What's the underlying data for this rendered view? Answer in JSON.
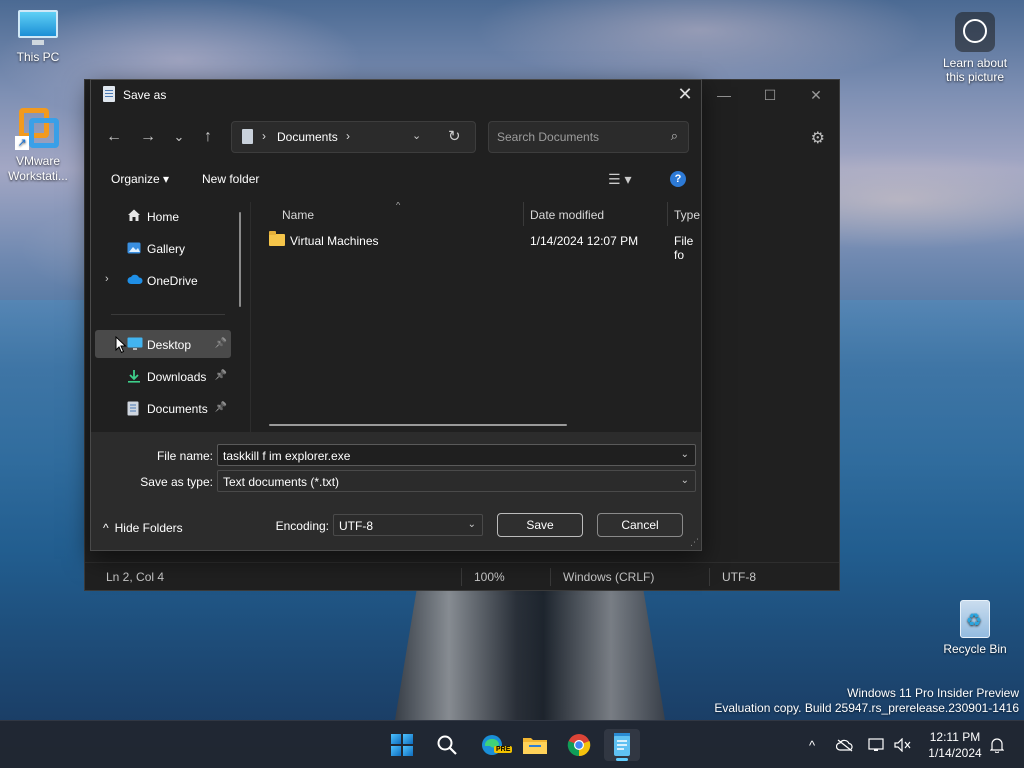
{
  "desktop": {
    "icons": [
      {
        "label": "This PC"
      },
      {
        "label": "VMware Workstati..."
      },
      {
        "label": "Recycle Bin"
      },
      {
        "label": "Learn about this picture"
      }
    ],
    "watermark": {
      "line1": "Windows 11 Pro Insider Preview",
      "line2": "Evaluation copy. Build 25947.rs_prerelease.230901-1416"
    }
  },
  "notepad": {
    "status": {
      "position": "Ln 2, Col 4",
      "zoom": "100%",
      "line_ending": "Windows (CRLF)",
      "encoding": "UTF-8"
    },
    "buttons": {
      "minimize": "—",
      "maximize": "☐",
      "close": "✕"
    },
    "settings_icon": "⚙"
  },
  "dialog": {
    "title": "Save as",
    "close_glyph": "✕",
    "nav": {
      "back": "←",
      "forward": "→",
      "recent": "⌄",
      "up": "↑"
    },
    "address": {
      "crumb": "Documents",
      "sep1": "›",
      "sep2": "›",
      "dropdown": "⌄",
      "refresh": "↻"
    },
    "search": {
      "placeholder": "Search Documents",
      "icon": "⌕"
    },
    "commands": {
      "organize": "Organize ▾",
      "new_folder": "New folder",
      "view": "☰ ▾",
      "help": "?"
    },
    "sidebar": {
      "items": [
        {
          "label": "Home"
        },
        {
          "label": "Gallery"
        },
        {
          "label": "OneDrive",
          "expander": "›"
        },
        {
          "label": "Desktop",
          "pin": "📌"
        },
        {
          "label": "Downloads",
          "pin": "📌"
        },
        {
          "label": "Documents",
          "pin": "📌"
        }
      ]
    },
    "files": {
      "columns": [
        "Name",
        "Date modified",
        "Type"
      ],
      "sort_glyph": "^",
      "rows": [
        {
          "name": "Virtual Machines",
          "date": "1/14/2024 12:07 PM",
          "type": "File fo"
        }
      ]
    },
    "form": {
      "file_name_label": "File name:",
      "file_name_value": "taskkill f im explorer.exe",
      "type_label": "Save as type:",
      "type_value": "Text documents (*.txt)",
      "encoding_label": "Encoding:",
      "encoding_value": "UTF-8",
      "save": "Save",
      "cancel": "Cancel",
      "hide_folders": "Hide Folders",
      "arrow": "⌄",
      "chevron_up": "^"
    }
  },
  "taskbar": {
    "clock_time": "12:11 PM",
    "clock_date": "1/14/2024",
    "edge_badge": "PRE",
    "tray": {
      "chevron": "^",
      "bell": "🔔"
    }
  }
}
